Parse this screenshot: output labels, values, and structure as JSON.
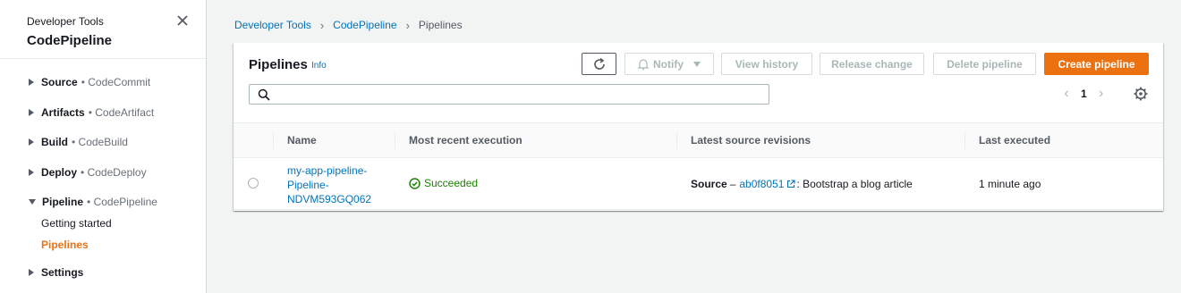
{
  "sidebar": {
    "service": "Developer Tools",
    "title": "CodePipeline",
    "groups": [
      {
        "label": "Source",
        "sub": "CodeCommit"
      },
      {
        "label": "Artifacts",
        "sub": "CodeArtifact"
      },
      {
        "label": "Build",
        "sub": "CodeBuild"
      },
      {
        "label": "Deploy",
        "sub": "CodeDeploy"
      },
      {
        "label": "Pipeline",
        "sub": "CodePipeline"
      },
      {
        "label": "Settings"
      }
    ],
    "pipeline_children": [
      "Getting started",
      "Pipelines"
    ]
  },
  "breadcrumb": {
    "items": [
      "Developer Tools",
      "CodePipeline"
    ],
    "current": "Pipelines"
  },
  "panel": {
    "title": "Pipelines",
    "info": "Info",
    "buttons": {
      "notify": "Notify",
      "view_history": "View history",
      "release_change": "Release change",
      "delete_pipeline": "Delete pipeline",
      "create_pipeline": "Create pipeline"
    },
    "search_placeholder": "",
    "page": "1"
  },
  "table": {
    "columns": [
      "Name",
      "Most recent execution",
      "Latest source revisions",
      "Last executed"
    ],
    "rows": [
      {
        "name": "my-app-pipeline-Pipeline-NDVM593GQ062",
        "status": "Succeeded",
        "source_label": "Source",
        "source_dash": "–",
        "revision_id": "ab0f8051",
        "revision_msg": ": Bootstrap a blog article",
        "last_executed": "1 minute ago"
      }
    ]
  },
  "colors": {
    "accent": "#ec7211",
    "link": "#0073bb",
    "success": "#1d8102"
  }
}
